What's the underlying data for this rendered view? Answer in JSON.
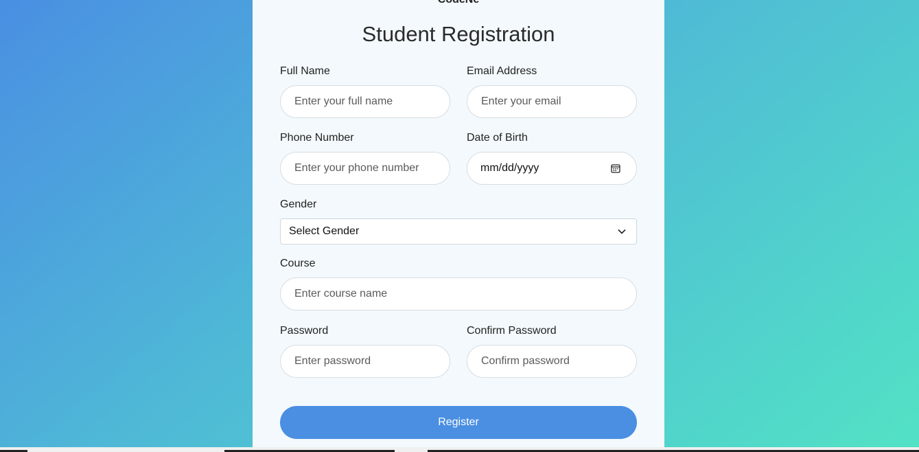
{
  "brand": {
    "text": "CodeNe"
  },
  "form": {
    "title": "Student Registration",
    "full_name": {
      "label": "Full Name",
      "placeholder": "Enter your full name"
    },
    "email": {
      "label": "Email Address",
      "placeholder": "Enter your email"
    },
    "phone": {
      "label": "Phone Number",
      "placeholder": "Enter your phone number"
    },
    "dob": {
      "label": "Date of Birth",
      "value": "mm/dd/yyyy",
      "icon": "calendar-icon"
    },
    "gender": {
      "label": "Gender",
      "selected": "Select Gender",
      "icon": "chevron-down-icon"
    },
    "course": {
      "label": "Course",
      "placeholder": "Enter course name"
    },
    "password": {
      "label": "Password",
      "placeholder": "Enter password"
    },
    "confirm_password": {
      "label": "Confirm Password",
      "placeholder": "Confirm password"
    },
    "submit_label": "Register"
  },
  "colors": {
    "gradient_start": "#4a8fe2",
    "gradient_end": "#52e2c5",
    "card_bg": "#f3f9fc",
    "button_bg": "#4a8fe2",
    "button_text": "#ffffff"
  }
}
